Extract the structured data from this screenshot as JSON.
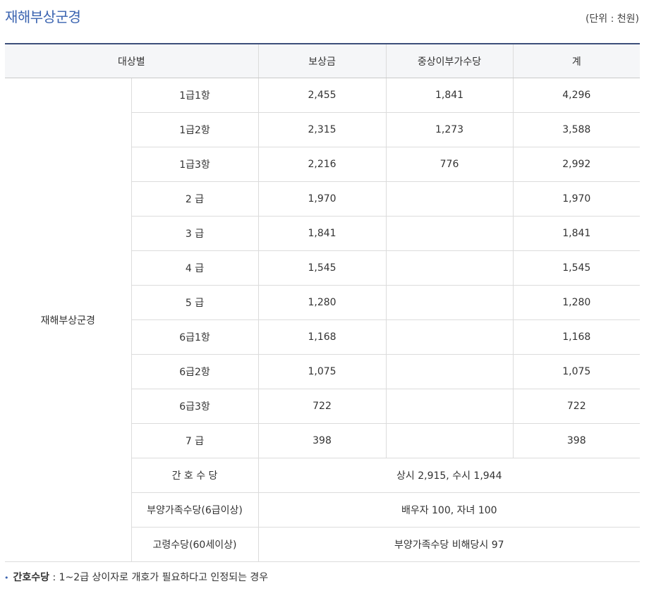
{
  "title": "재해부상군경",
  "unit": "(단위 : 천원)",
  "headers": [
    "대상별",
    "보상금",
    "중상이부가수당",
    "계"
  ],
  "group_label": "재해부상군경",
  "rows": [
    {
      "grade": "1급1항",
      "comp": "2,455",
      "extra": "1,841",
      "total": "4,296"
    },
    {
      "grade": "1급2항",
      "comp": "2,315",
      "extra": "1,273",
      "total": "3,588"
    },
    {
      "grade": "1급3항",
      "comp": "2,216",
      "extra": "776",
      "total": "2,992"
    },
    {
      "grade": "2 급",
      "comp": "1,970",
      "extra": "",
      "total": "1,970"
    },
    {
      "grade": "3 급",
      "comp": "1,841",
      "extra": "",
      "total": "1,841"
    },
    {
      "grade": "4 급",
      "comp": "1,545",
      "extra": "",
      "total": "1,545"
    },
    {
      "grade": "5 급",
      "comp": "1,280",
      "extra": "",
      "total": "1,280"
    },
    {
      "grade": "6급1항",
      "comp": "1,168",
      "extra": "",
      "total": "1,168"
    },
    {
      "grade": "6급2항",
      "comp": "1,075",
      "extra": "",
      "total": "1,075"
    },
    {
      "grade": "6급3항",
      "comp": "722",
      "extra": "",
      "total": "722"
    },
    {
      "grade": "7 급",
      "comp": "398",
      "extra": "",
      "total": "398"
    }
  ],
  "allowances": [
    {
      "label": "간 호 수 당",
      "value": "상시 2,915, 수시 1,944"
    },
    {
      "label": "부양가족수당(6급이상)",
      "value": "배우자 100, 자녀 100"
    },
    {
      "label": "고령수당(60세이상)",
      "value": "부양가족수당 비해당시 97"
    }
  ],
  "note": {
    "bullet": "•",
    "term": "간호수당",
    "text": " : 1~2급 상이자로 개호가 필요하다고 인정되는 경우"
  }
}
